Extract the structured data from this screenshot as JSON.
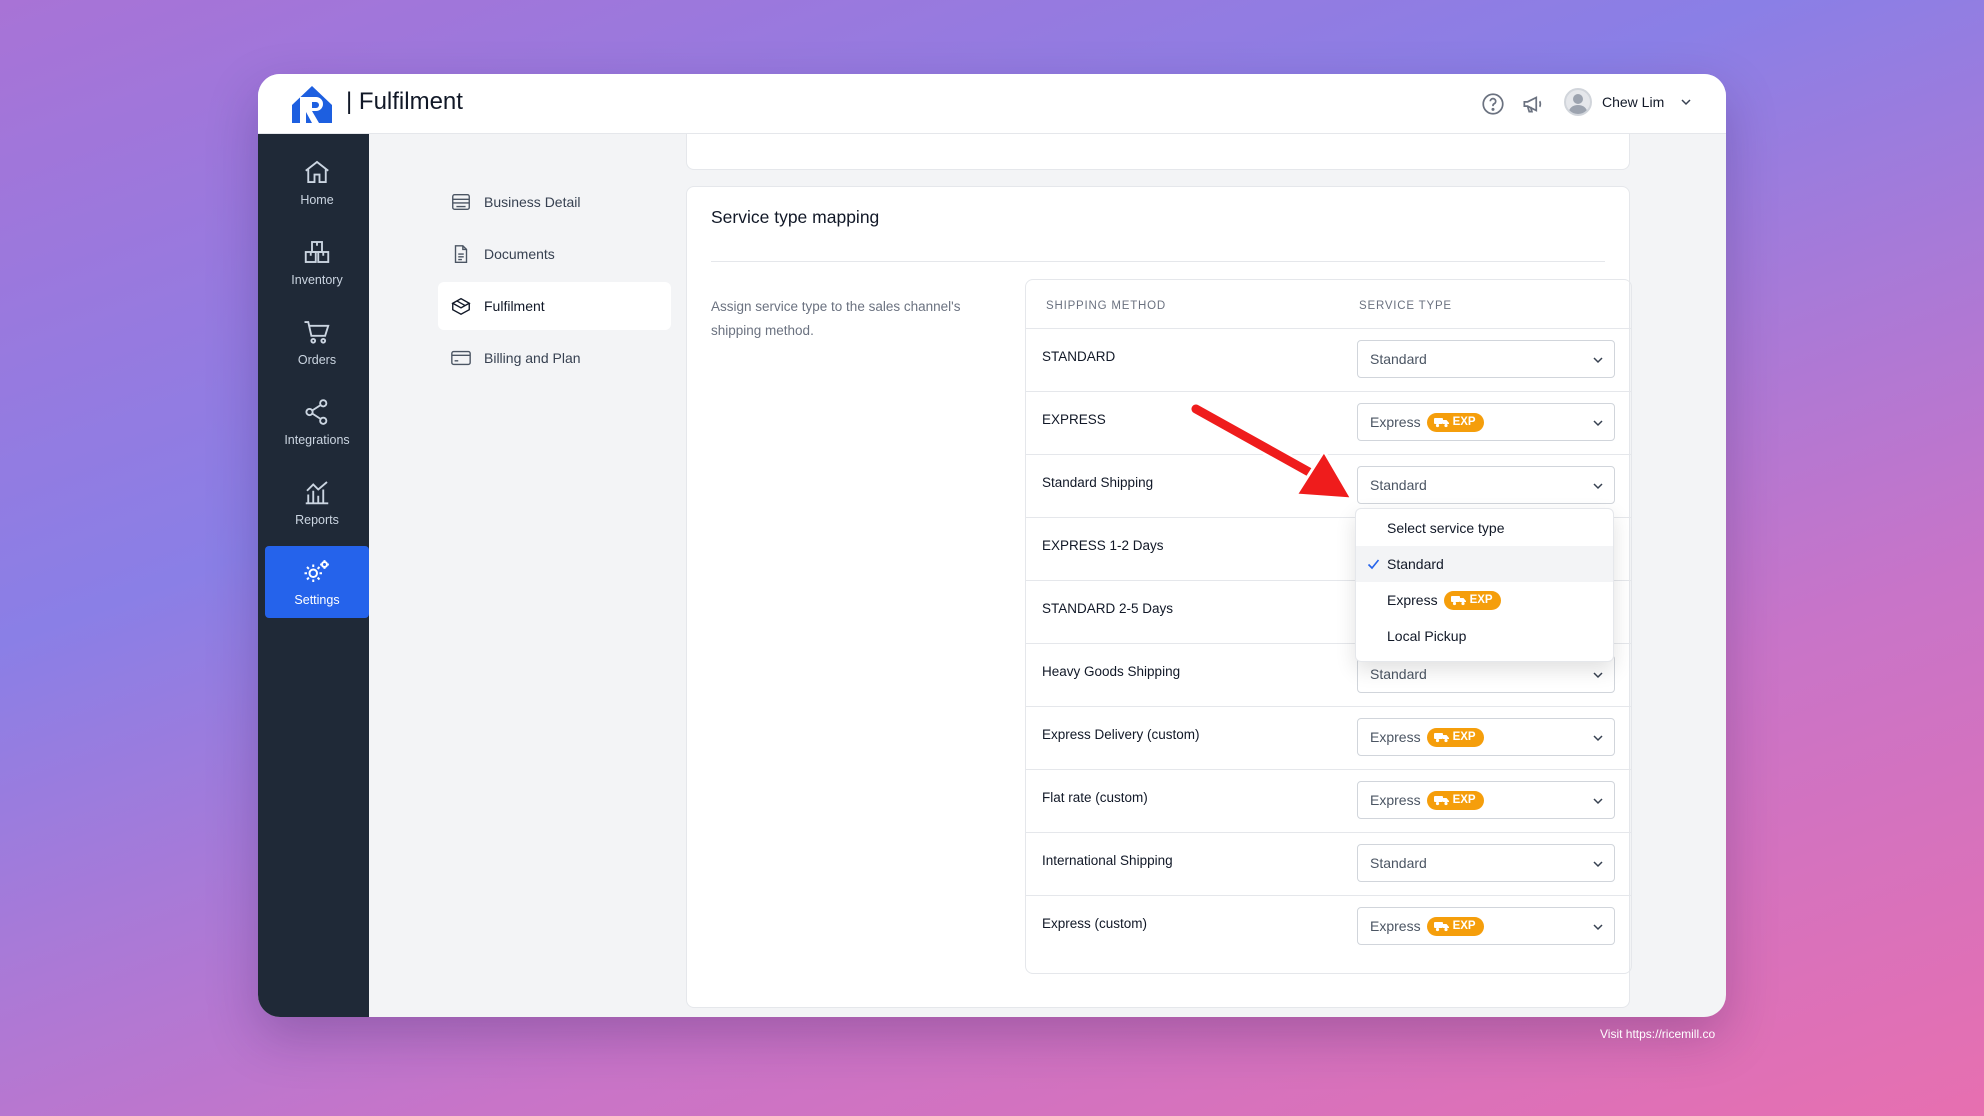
{
  "app": {
    "title": "| Fulfilment"
  },
  "header": {
    "help_icon": "question-circle-icon",
    "announce_icon": "megaphone-icon",
    "user_name": "Chew Lim"
  },
  "sidebar": {
    "items": [
      {
        "label": "Home",
        "icon": "home-icon"
      },
      {
        "label": "Inventory",
        "icon": "boxes-icon"
      },
      {
        "label": "Orders",
        "icon": "cart-icon"
      },
      {
        "label": "Integrations",
        "icon": "share-icon"
      },
      {
        "label": "Reports",
        "icon": "chart-icon"
      },
      {
        "label": "Settings",
        "icon": "gears-icon",
        "active": true
      }
    ]
  },
  "subnav": {
    "items": [
      {
        "label": "Business Detail",
        "icon": "store-icon"
      },
      {
        "label": "Documents",
        "icon": "document-icon"
      },
      {
        "label": "Fulfilment",
        "icon": "package-icon",
        "active": true
      },
      {
        "label": "Billing and Plan",
        "icon": "credit-card-icon"
      }
    ]
  },
  "mapping": {
    "title": "Service type mapping",
    "description": "Assign service type to the sales channel's shipping method.",
    "columns": {
      "method": "SHIPPING METHOD",
      "service": "SERVICE TYPE"
    },
    "rows": [
      {
        "method": "STANDARD",
        "service": "Standard",
        "badge": ""
      },
      {
        "method": "EXPRESS",
        "service": "Express",
        "badge": "EXP"
      },
      {
        "method": "Standard Shipping",
        "service": "Standard",
        "badge": ""
      },
      {
        "method": "EXPRESS 1-2 Days",
        "service": "",
        "badge": ""
      },
      {
        "method": "STANDARD 2-5 Days",
        "service": "",
        "badge": ""
      },
      {
        "method": "Heavy Goods Shipping",
        "service": "Standard",
        "badge": ""
      },
      {
        "method": "Express Delivery (custom)",
        "service": "Express",
        "badge": "EXP"
      },
      {
        "method": "Flat rate (custom)",
        "service": "Express",
        "badge": "EXP"
      },
      {
        "method": "International Shipping",
        "service": "Standard",
        "badge": ""
      },
      {
        "method": "Express (custom)",
        "service": "Express",
        "badge": "EXP"
      }
    ]
  },
  "dropdown": {
    "options": [
      {
        "label": "Select service type",
        "badge": ""
      },
      {
        "label": "Standard",
        "badge": "",
        "selected": true
      },
      {
        "label": "Express",
        "badge": "EXP"
      },
      {
        "label": "Local Pickup",
        "badge": ""
      }
    ]
  },
  "colors": {
    "accent": "#2563eb",
    "badge": "#f59e0b",
    "sidebar": "#1f2937",
    "arrow": "#ef1c1c"
  },
  "footer": {
    "note": "Visit https://ricemill.co"
  }
}
